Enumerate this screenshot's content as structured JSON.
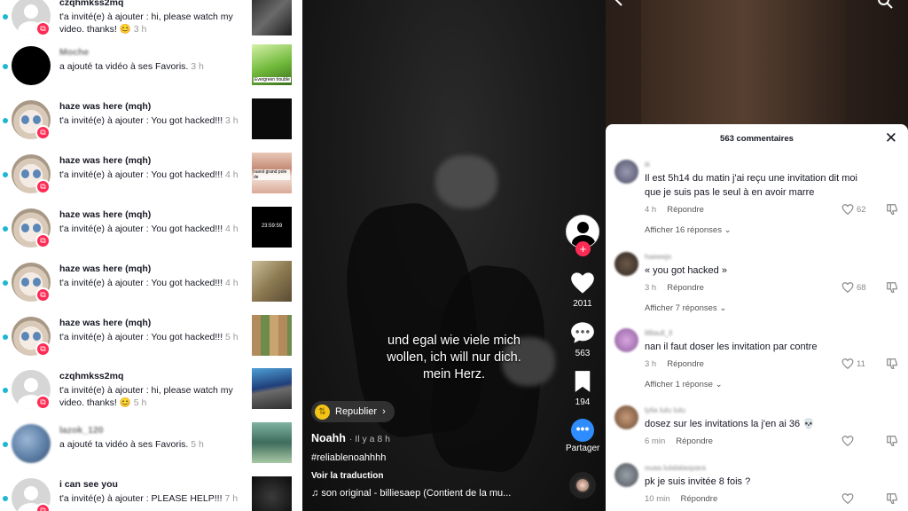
{
  "notifications": [
    {
      "name": "czqhmkss2mq",
      "message": "t'a invité(e) à ajouter : hi, please watch my video. thanks! 😊",
      "time": "3 h",
      "avatar": "gray",
      "badge": true,
      "blur": false
    },
    {
      "name": "Moche",
      "message": "a ajouté ta vidéo à ses Favoris.",
      "time": "3 h",
      "avatar": "black",
      "badge": false,
      "blur": true
    },
    {
      "name": "haze was here (mqh)",
      "message": "t'a invité(e) à ajouter : You got hacked!!!",
      "time": "3 h",
      "avatar": "cat",
      "badge": true,
      "blur": false
    },
    {
      "name": "haze was here (mqh)",
      "message": "t'a invité(e) à ajouter : You got hacked!!!",
      "time": "4 h",
      "avatar": "cat",
      "badge": true,
      "blur": false
    },
    {
      "name": "haze was here (mqh)",
      "message": "t'a invité(e) à ajouter : You got hacked!!!",
      "time": "4 h",
      "avatar": "cat",
      "badge": true,
      "blur": false
    },
    {
      "name": "haze was here (mqh)",
      "message": "t'a invité(e) à ajouter : You got hacked!!!",
      "time": "4 h",
      "avatar": "cat",
      "badge": true,
      "blur": false
    },
    {
      "name": "haze was here (mqh)",
      "message": "t'a invité(e) à ajouter : You got hacked!!!",
      "time": "5 h",
      "avatar": "cat",
      "badge": true,
      "blur": false
    },
    {
      "name": "czqhmkss2mq",
      "message": "t'a invité(e) à ajouter : hi, please watch my video. thanks! 😊",
      "time": "5 h",
      "avatar": "gray",
      "badge": true,
      "blur": false
    },
    {
      "name": "lazok_120",
      "message": "a ajouté ta vidéo à ses Favoris.",
      "time": "5 h",
      "avatar": "blur",
      "badge": false,
      "blur": true
    },
    {
      "name": "i can see you",
      "message": "t'a invité(e) à ajouter : PLEASE HELP!!!",
      "time": "7 h",
      "avatar": "gray",
      "badge": true,
      "blur": false
    }
  ],
  "thumbnail_labels": {
    "n1": "Evergreen trouble",
    "n3": "ouest grand pole de",
    "n4": "23:59:59"
  },
  "video": {
    "caption_lines": [
      "und egal wie viele mich",
      "wollen, ich will nur dich.",
      "mein Herz."
    ],
    "likes": "2011",
    "comments": "563",
    "saves": "194",
    "share_label": "Partager",
    "repost_label": "Republier",
    "author": "Noahh",
    "ago": "· Il y a 8 h",
    "hashtag": "#reliablenoahhhh",
    "translate": "Voir la traduction",
    "music": "son original - billiesaep (Contient de la mu..."
  },
  "comments_sheet": {
    "title": "563 commentaires",
    "comments": [
      {
        "user": "iii",
        "text": "Il est 5h14 du matin j'ai reçu une invitation dit moi que je suis pas le seul à en avoir marre",
        "time": "4 h",
        "reply": "Répondre",
        "likes": "62",
        "replies": "Afficher 16 réponses"
      },
      {
        "user": "haeeejo",
        "text": "« you got hacked »",
        "time": "3 h",
        "reply": "Répondre",
        "likes": "68",
        "replies": "Afficher 7 réponses"
      },
      {
        "user": "lilllaull_ll",
        "text": "nan il faut doser les invitation par contre",
        "time": "3 h",
        "reply": "Répondre",
        "likes": "11",
        "replies": "Afficher 1 réponse"
      },
      {
        "user": "lylia lulu lulu",
        "text": "dosez sur les invitations la j'en ai 36 💀",
        "time": "6 min",
        "reply": "Répondre",
        "likes": "",
        "replies": ""
      },
      {
        "user": "ouaa.lulalalaspara",
        "text": "pk je suis invitée 8 fois ?",
        "time": "10 min",
        "reply": "Répondre",
        "likes": "",
        "replies": ""
      }
    ]
  },
  "colors": {
    "accent": "#fe2c55",
    "unread_dot": "#1fb6d3",
    "share": "#2f8cff"
  }
}
